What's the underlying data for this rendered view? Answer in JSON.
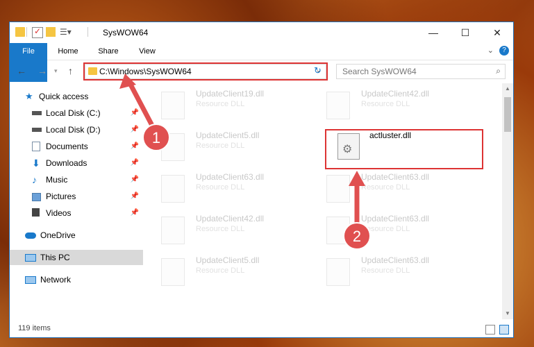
{
  "window": {
    "title": "SysWOW64"
  },
  "ribbon": {
    "tabs": [
      "File",
      "Home",
      "Share",
      "View"
    ]
  },
  "nav": {
    "address": "C:\\Windows\\SysWOW64",
    "search_placeholder": "Search SysWOW64"
  },
  "sidebar": {
    "items": [
      {
        "label": "Quick access",
        "icon": "star-icon"
      },
      {
        "label": "Local Disk (C:)",
        "icon": "drive-icon",
        "pinned": true
      },
      {
        "label": "Local Disk (D:)",
        "icon": "drive-icon",
        "pinned": true
      },
      {
        "label": "Documents",
        "icon": "documents-icon",
        "pinned": true
      },
      {
        "label": "Downloads",
        "icon": "downloads-icon",
        "pinned": true
      },
      {
        "label": "Music",
        "icon": "music-icon",
        "pinned": true
      },
      {
        "label": "Pictures",
        "icon": "pictures-icon",
        "pinned": true
      },
      {
        "label": "Videos",
        "icon": "videos-icon",
        "pinned": true
      },
      {
        "label": "OneDrive",
        "icon": "cloud-icon"
      },
      {
        "label": "This PC",
        "icon": "computer-icon",
        "selected": true
      },
      {
        "label": "Network",
        "icon": "network-icon"
      }
    ]
  },
  "files": [
    {
      "name": "UpdateClient19.dll",
      "desc": "Resource DLL"
    },
    {
      "name": "UpdateClient42.dll",
      "desc": "Resource DLL"
    },
    {
      "name": "UpdateClient5.dll",
      "desc": "Resource DLL"
    },
    {
      "name": "actluster.dll",
      "desc": ""
    },
    {
      "name": "UpdateClient63.dll",
      "desc": "Resource DLL"
    },
    {
      "name": "UpdateClient63.dll",
      "desc": "Resource DLL"
    },
    {
      "name": "UpdateClient42.dll",
      "desc": "Resource DLL"
    },
    {
      "name": "UpdateClient63.dll",
      "desc": "Resource DLL"
    },
    {
      "name": "UpdateClient5.dll",
      "desc": "Resource DLL"
    },
    {
      "name": "UpdateClient63.dll",
      "desc": "Resource DLL"
    }
  ],
  "status": {
    "count": "119 items"
  },
  "markers": [
    "1",
    "2"
  ],
  "colors": {
    "accent": "#1979ca",
    "highlight": "#d33333",
    "marker": "#e05050"
  }
}
